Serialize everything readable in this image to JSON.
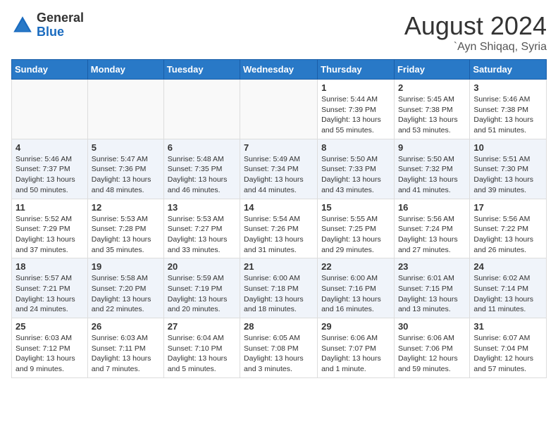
{
  "logo": {
    "general": "General",
    "blue": "Blue"
  },
  "title": "August 2024",
  "location": "`Ayn Shiqaq, Syria",
  "weekdays": [
    "Sunday",
    "Monday",
    "Tuesday",
    "Wednesday",
    "Thursday",
    "Friday",
    "Saturday"
  ],
  "weeks": [
    [
      {
        "day": "",
        "info": ""
      },
      {
        "day": "",
        "info": ""
      },
      {
        "day": "",
        "info": ""
      },
      {
        "day": "",
        "info": ""
      },
      {
        "day": "1",
        "info": "Sunrise: 5:44 AM\nSunset: 7:39 PM\nDaylight: 13 hours\nand 55 minutes."
      },
      {
        "day": "2",
        "info": "Sunrise: 5:45 AM\nSunset: 7:38 PM\nDaylight: 13 hours\nand 53 minutes."
      },
      {
        "day": "3",
        "info": "Sunrise: 5:46 AM\nSunset: 7:38 PM\nDaylight: 13 hours\nand 51 minutes."
      }
    ],
    [
      {
        "day": "4",
        "info": "Sunrise: 5:46 AM\nSunset: 7:37 PM\nDaylight: 13 hours\nand 50 minutes."
      },
      {
        "day": "5",
        "info": "Sunrise: 5:47 AM\nSunset: 7:36 PM\nDaylight: 13 hours\nand 48 minutes."
      },
      {
        "day": "6",
        "info": "Sunrise: 5:48 AM\nSunset: 7:35 PM\nDaylight: 13 hours\nand 46 minutes."
      },
      {
        "day": "7",
        "info": "Sunrise: 5:49 AM\nSunset: 7:34 PM\nDaylight: 13 hours\nand 44 minutes."
      },
      {
        "day": "8",
        "info": "Sunrise: 5:50 AM\nSunset: 7:33 PM\nDaylight: 13 hours\nand 43 minutes."
      },
      {
        "day": "9",
        "info": "Sunrise: 5:50 AM\nSunset: 7:32 PM\nDaylight: 13 hours\nand 41 minutes."
      },
      {
        "day": "10",
        "info": "Sunrise: 5:51 AM\nSunset: 7:30 PM\nDaylight: 13 hours\nand 39 minutes."
      }
    ],
    [
      {
        "day": "11",
        "info": "Sunrise: 5:52 AM\nSunset: 7:29 PM\nDaylight: 13 hours\nand 37 minutes."
      },
      {
        "day": "12",
        "info": "Sunrise: 5:53 AM\nSunset: 7:28 PM\nDaylight: 13 hours\nand 35 minutes."
      },
      {
        "day": "13",
        "info": "Sunrise: 5:53 AM\nSunset: 7:27 PM\nDaylight: 13 hours\nand 33 minutes."
      },
      {
        "day": "14",
        "info": "Sunrise: 5:54 AM\nSunset: 7:26 PM\nDaylight: 13 hours\nand 31 minutes."
      },
      {
        "day": "15",
        "info": "Sunrise: 5:55 AM\nSunset: 7:25 PM\nDaylight: 13 hours\nand 29 minutes."
      },
      {
        "day": "16",
        "info": "Sunrise: 5:56 AM\nSunset: 7:24 PM\nDaylight: 13 hours\nand 27 minutes."
      },
      {
        "day": "17",
        "info": "Sunrise: 5:56 AM\nSunset: 7:22 PM\nDaylight: 13 hours\nand 26 minutes."
      }
    ],
    [
      {
        "day": "18",
        "info": "Sunrise: 5:57 AM\nSunset: 7:21 PM\nDaylight: 13 hours\nand 24 minutes."
      },
      {
        "day": "19",
        "info": "Sunrise: 5:58 AM\nSunset: 7:20 PM\nDaylight: 13 hours\nand 22 minutes."
      },
      {
        "day": "20",
        "info": "Sunrise: 5:59 AM\nSunset: 7:19 PM\nDaylight: 13 hours\nand 20 minutes."
      },
      {
        "day": "21",
        "info": "Sunrise: 6:00 AM\nSunset: 7:18 PM\nDaylight: 13 hours\nand 18 minutes."
      },
      {
        "day": "22",
        "info": "Sunrise: 6:00 AM\nSunset: 7:16 PM\nDaylight: 13 hours\nand 16 minutes."
      },
      {
        "day": "23",
        "info": "Sunrise: 6:01 AM\nSunset: 7:15 PM\nDaylight: 13 hours\nand 13 minutes."
      },
      {
        "day": "24",
        "info": "Sunrise: 6:02 AM\nSunset: 7:14 PM\nDaylight: 13 hours\nand 11 minutes."
      }
    ],
    [
      {
        "day": "25",
        "info": "Sunrise: 6:03 AM\nSunset: 7:12 PM\nDaylight: 13 hours\nand 9 minutes."
      },
      {
        "day": "26",
        "info": "Sunrise: 6:03 AM\nSunset: 7:11 PM\nDaylight: 13 hours\nand 7 minutes."
      },
      {
        "day": "27",
        "info": "Sunrise: 6:04 AM\nSunset: 7:10 PM\nDaylight: 13 hours\nand 5 minutes."
      },
      {
        "day": "28",
        "info": "Sunrise: 6:05 AM\nSunset: 7:08 PM\nDaylight: 13 hours\nand 3 minutes."
      },
      {
        "day": "29",
        "info": "Sunrise: 6:06 AM\nSunset: 7:07 PM\nDaylight: 13 hours\nand 1 minute."
      },
      {
        "day": "30",
        "info": "Sunrise: 6:06 AM\nSunset: 7:06 PM\nDaylight: 12 hours\nand 59 minutes."
      },
      {
        "day": "31",
        "info": "Sunrise: 6:07 AM\nSunset: 7:04 PM\nDaylight: 12 hours\nand 57 minutes."
      }
    ]
  ]
}
